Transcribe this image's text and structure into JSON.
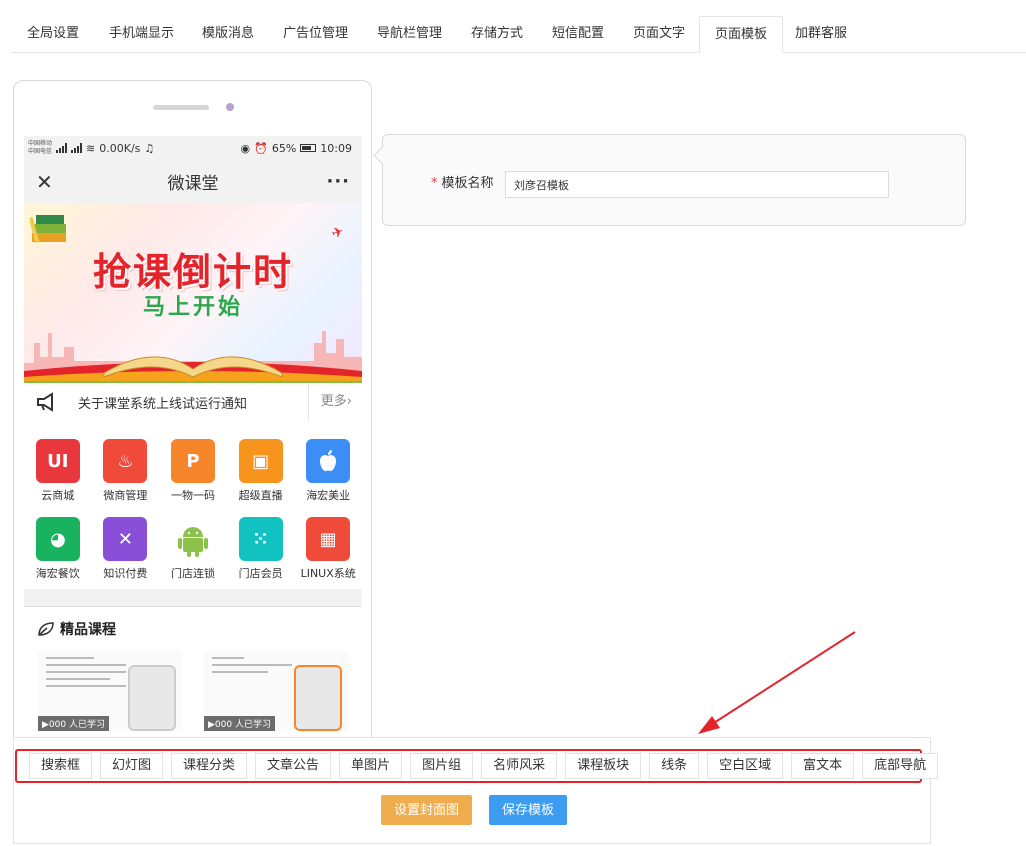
{
  "tabs": [
    {
      "label": "全局设置"
    },
    {
      "label": "手机端显示"
    },
    {
      "label": "模版消息"
    },
    {
      "label": "广告位管理"
    },
    {
      "label": "导航栏管理"
    },
    {
      "label": "存储方式"
    },
    {
      "label": "短信配置"
    },
    {
      "label": "页面文字"
    },
    {
      "label": "页面模板",
      "active": true
    },
    {
      "label": "加群客服"
    }
  ],
  "phone": {
    "status": {
      "carrier1": "中国移动",
      "carrier2": "中国电信",
      "speed": "0.00K/s",
      "battery": "65%",
      "time": "10:09"
    },
    "title": "微课堂",
    "banner": {
      "title": "抢课倒计时",
      "subtitle": "马上开始"
    },
    "notice": {
      "text": "关于课堂系统上线试运行通知",
      "more": "更多›"
    },
    "apps": [
      {
        "label": "云商城",
        "icon": "UI",
        "color": "#e8383d"
      },
      {
        "label": "微商管理",
        "icon": "♨",
        "color": "#f04a3a"
      },
      {
        "label": "一物一码",
        "icon": "P",
        "color": "#f7862b"
      },
      {
        "label": "超级直播",
        "icon": "▣",
        "color": "#f7941d"
      },
      {
        "label": "海宏美业",
        "icon": "",
        "color": "#3a8ef6"
      },
      {
        "label": "海宏餐饮",
        "icon": "◕",
        "color": "#19b360"
      },
      {
        "label": "知识付费",
        "icon": "✕",
        "color": "#8a4fd8"
      },
      {
        "label": "门店连锁",
        "icon": "",
        "color": "#ffffff"
      },
      {
        "label": "门店会员",
        "icon": "⁙",
        "color": "#12c2c0"
      },
      {
        "label": "LINUX系统",
        "icon": "▦",
        "color": "#f04a3a"
      }
    ],
    "courses": {
      "title": "精品课程",
      "card_tag": "▶000 人已学习"
    }
  },
  "form": {
    "label": "模板名称",
    "value": "刘彦召模板"
  },
  "components": [
    "搜索框",
    "幻灯图",
    "课程分类",
    "文章公告",
    "单图片",
    "图片组",
    "名师风采",
    "课程板块",
    "线条",
    "空白区域",
    "富文本",
    "底部导航"
  ],
  "buttons": {
    "cover": "设置封面图",
    "save": "保存模板"
  }
}
